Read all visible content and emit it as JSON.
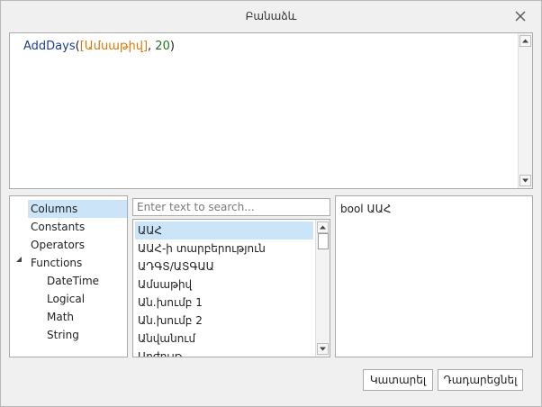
{
  "dialog": {
    "title": "Բանաձև"
  },
  "editor": {
    "function_name": "AddDays",
    "open_paren": "(",
    "field": "[Ամսաթիվ]",
    "separator": ", ",
    "argument": "20",
    "close_paren": ")"
  },
  "tree": {
    "items": [
      {
        "label": "Columns",
        "selected": true
      },
      {
        "label": "Constants"
      },
      {
        "label": "Operators"
      },
      {
        "label": "Functions",
        "expanded": true
      },
      {
        "label": "DateTime"
      },
      {
        "label": "Logical"
      },
      {
        "label": "Math"
      },
      {
        "label": "String"
      }
    ]
  },
  "search": {
    "placeholder": "Enter text to search..."
  },
  "fields_list": {
    "items": [
      "ԱԱՀ",
      "ԱԱՀ-ի տարբերություն",
      "ԱԴԳՏ/ԱՏԳԱԱ",
      "Ամսաթիվ",
      "Ան.խումբ 1",
      "Ան.խումբ 2",
      "Անվանում",
      "Արժույթ"
    ]
  },
  "description": {
    "text": "bool ԱԱՀ"
  },
  "buttons": {
    "ok_label": "Կատարել",
    "cancel_label": "Դադարեցնել"
  },
  "colors": {
    "function": "#1e3f8f",
    "field": "#d6780a",
    "number": "#1a7a1a",
    "selection": "#cce4f7"
  }
}
